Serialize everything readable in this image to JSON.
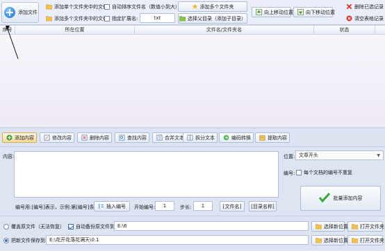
{
  "toolbar": {
    "add_file": "添加文件",
    "add_single_folder_files": "添加单个文件夹中的文件",
    "add_multi_folder_files": "添加多个文件夹中的文件",
    "auto_sort": "自动排序文件名（数值小到大）",
    "specify_ext": "指定扩展名:",
    "ext_value": "txt",
    "add_multi_folders": "添加多个文件夹",
    "select_dir": "选择父目录（添加子目录）",
    "move_up": "向上移动位置",
    "move_down": "向下移动位置",
    "delete_selected": "删除已选记录",
    "clear_table": "清空表格记录"
  },
  "table": {
    "columns": [
      "序号",
      "所在位置",
      "文件名/文件夹名",
      "状态"
    ]
  },
  "actions": [
    {
      "label": "添加内容",
      "icon": "add-icon"
    },
    {
      "label": "修改内容",
      "icon": "edit-icon"
    },
    {
      "label": "删除内容",
      "icon": "delete-icon"
    },
    {
      "label": "查找内容",
      "icon": "find-icon"
    },
    {
      "label": "合并文本",
      "icon": "merge-icon"
    },
    {
      "label": "拆分文本",
      "icon": "split-icon"
    },
    {
      "label": "编码转换",
      "icon": "encode-icon"
    },
    {
      "label": "提取内容",
      "icon": "extract-icon"
    }
  ],
  "editor": {
    "content_label": "内容:",
    "position_label": "位置:",
    "position_value": "文章开头",
    "number_label": "编号:",
    "number_check": "每个文档的编号不重复",
    "hint": "编号用:[编号]表示，示例:第[编号]条",
    "insert_number": "插入编号",
    "start_label": "开始编号:",
    "start_value": "1",
    "step_label": "步长:",
    "step_value": "1",
    "file_name_tag": "[文件名]",
    "dir_name_tag": "[目录名称]",
    "batch_add": "批量添加内容"
  },
  "bottom": {
    "overwrite_label": "覆盖原文件（无法恢复）",
    "auto_backup_label": "自动备份原文件到:",
    "backup_path": "E:\\6",
    "save_new_label": "把新文件保存到:",
    "save_path": "E:\\花开花落花满天\\0.1",
    "choose_location": "选择新位置",
    "open_folder": "打开文件夹"
  },
  "colors": {
    "accent_blue": "#2b78d4",
    "delete_red": "#d8322f",
    "bg": "#dfe6f3"
  }
}
